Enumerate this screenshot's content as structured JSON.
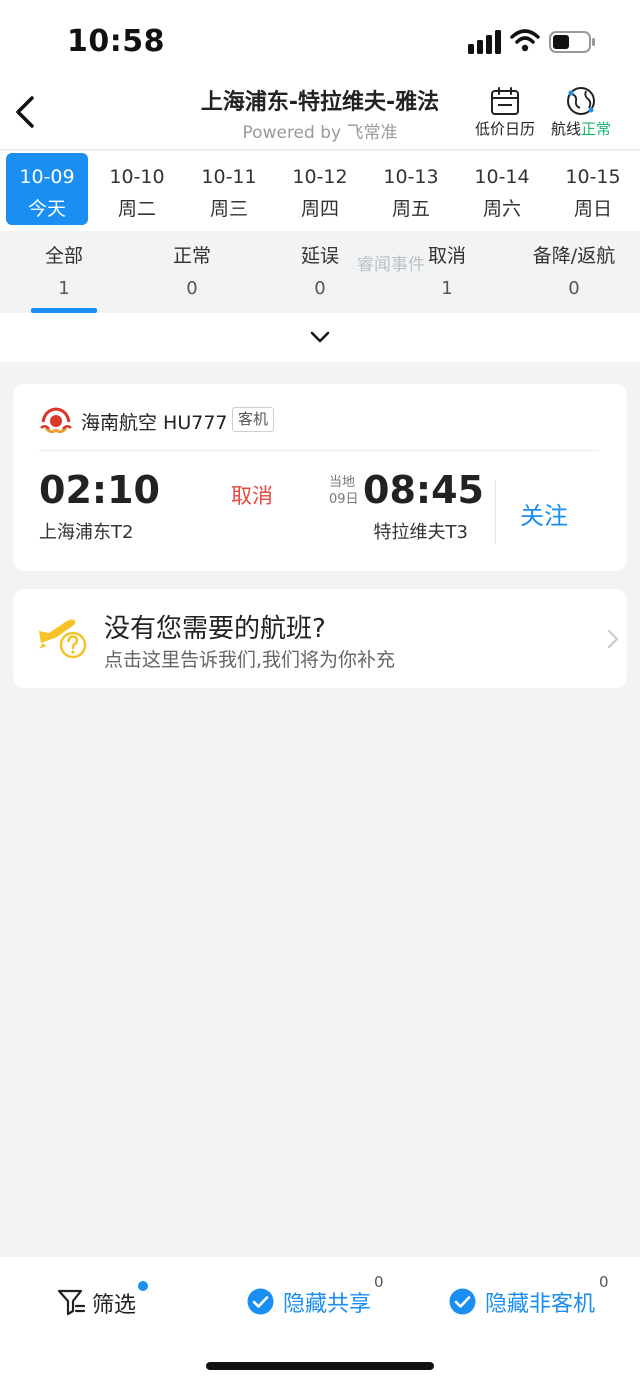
{
  "status_bar": {
    "time": "10:58"
  },
  "header": {
    "route_title": "上海浦东-特拉维夫-雅法",
    "powered_by": "Powered by 飞常准",
    "calendar_label": "低价日历",
    "route_label_prefix": "航线",
    "route_label_status": "正常"
  },
  "dates": [
    {
      "date": "10-09",
      "weekday": "今天",
      "active": true
    },
    {
      "date": "10-10",
      "weekday": "周二"
    },
    {
      "date": "10-11",
      "weekday": "周三"
    },
    {
      "date": "10-12",
      "weekday": "周四"
    },
    {
      "date": "10-13",
      "weekday": "周五"
    },
    {
      "date": "10-14",
      "weekday": "周六"
    },
    {
      "date": "10-15",
      "weekday": "周日"
    }
  ],
  "filter_tabs": [
    {
      "label": "全部",
      "count": "1"
    },
    {
      "label": "正常",
      "count": "0"
    },
    {
      "label": "延误",
      "count": "0"
    },
    {
      "label": "取消",
      "count": "1"
    },
    {
      "label": "备降/返航",
      "count": "0"
    }
  ],
  "watermark": "睿闻事件",
  "flight": {
    "airline": "海南航空 HU777",
    "aircraft_tag": "客机",
    "dep_time": "02:10",
    "dep_airport": "上海浦东T2",
    "status": "取消",
    "local_label_1": "当地",
    "local_label_2": "09日",
    "arr_time": "08:45",
    "arr_airport": "特拉维夫T3",
    "follow": "关注"
  },
  "feedback": {
    "title": "没有您需要的航班?",
    "subtitle": "点击这里告诉我们,我们将为你补充"
  },
  "bottom_bar": {
    "filter": "筛选",
    "hide_shared": "隐藏共享",
    "hide_shared_count": "0",
    "hide_nonpax": "隐藏非客机",
    "hide_nonpax_count": "0"
  },
  "colors": {
    "accent": "#1b8ef1",
    "cancel": "#e8473e",
    "ok": "#19b46b"
  }
}
